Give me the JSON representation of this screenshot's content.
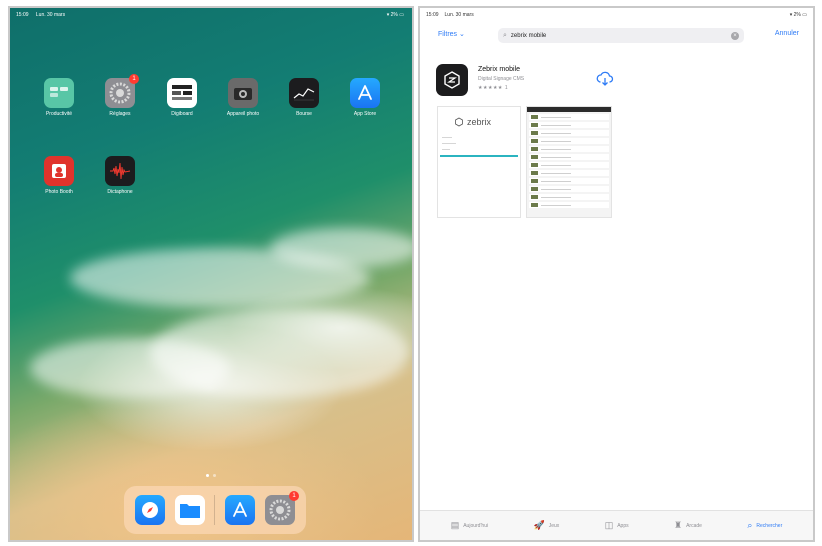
{
  "home": {
    "status": {
      "time": "15:09",
      "date": "Lun. 30 mars",
      "battery": "2%"
    },
    "apps": [
      {
        "label": "Productivité",
        "icon": "folder-icon",
        "color": "#58c6a6"
      },
      {
        "label": "Réglages",
        "icon": "settings-icon",
        "color": "#8e8e93",
        "badge": "1"
      },
      {
        "label": "Digiboard",
        "icon": "digiboard-icon",
        "color": "#ffffff"
      },
      {
        "label": "Appareil photo",
        "icon": "camera-icon",
        "color": "#6a6a6a"
      },
      {
        "label": "Bourse",
        "icon": "stocks-icon",
        "color": "#1c1c1e"
      },
      {
        "label": "App Store",
        "icon": "app-store-icon",
        "color": "#1a8cff"
      },
      {
        "label": "Photo Booth",
        "icon": "photo-booth-icon",
        "color": "#e0332c"
      },
      {
        "label": "Dictaphone",
        "icon": "voice-memos-icon",
        "color": "#1c1c1e"
      }
    ],
    "page_count": 2,
    "dock": [
      {
        "icon": "safari-icon",
        "color": "#1a8cff"
      },
      {
        "icon": "files-icon",
        "color": "#1a8cff"
      },
      {
        "icon": "app-store-icon",
        "color": "#1a8cff"
      },
      {
        "icon": "settings-icon",
        "color": "#8e8e93",
        "badge": "1"
      }
    ]
  },
  "store": {
    "status": {
      "time": "15:09",
      "date": "Lun. 30 mars",
      "battery": "2%"
    },
    "filters_label": "Filtres",
    "search_value": "zebrix mobile",
    "cancel_label": "Annuler",
    "result": {
      "name": "Zebrix mobile",
      "subtitle": "Digital Signage CMS",
      "stars": "★★★★★",
      "rating_count": "1"
    },
    "screenshot_logo": "zebrix",
    "tabs": [
      {
        "label": "Aujourd'hui",
        "icon": "today-icon"
      },
      {
        "label": "Jeux",
        "icon": "games-icon"
      },
      {
        "label": "Apps",
        "icon": "apps-icon"
      },
      {
        "label": "Arcade",
        "icon": "arcade-icon"
      },
      {
        "label": "Rechercher",
        "icon": "search-icon",
        "active": true
      }
    ]
  }
}
